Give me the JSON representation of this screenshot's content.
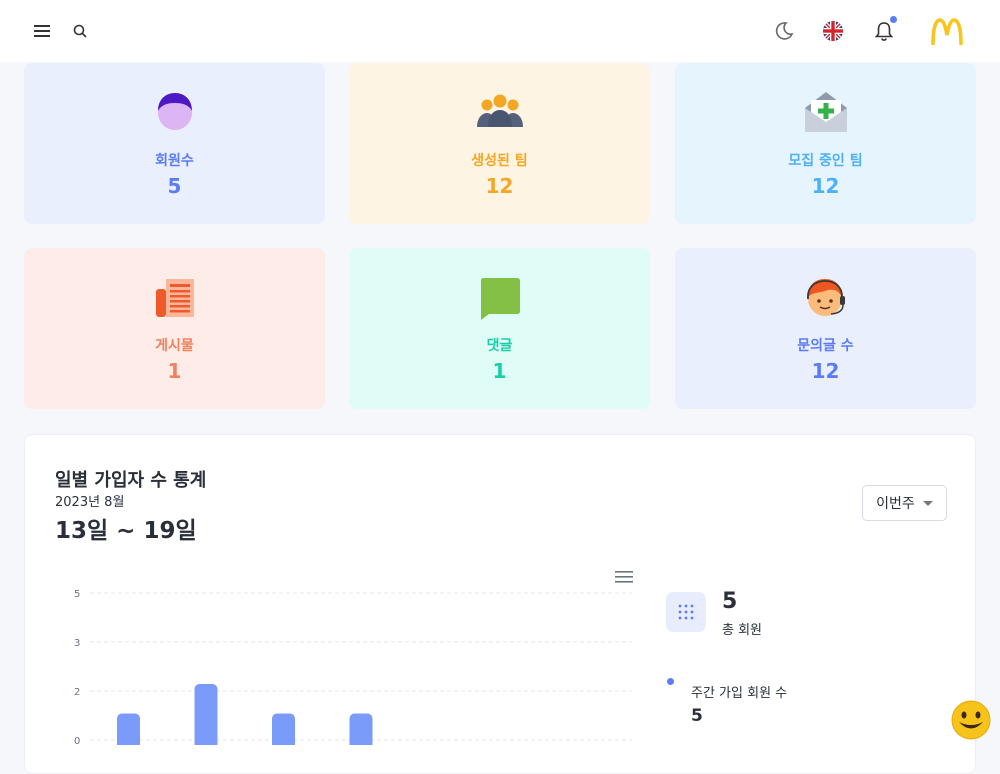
{
  "topbar": {
    "icons": [
      "menu-icon",
      "search-icon",
      "moon-icon",
      "uk-flag-icon",
      "bell-icon",
      "mcdonalds-logo"
    ],
    "has_notification": true
  },
  "cards": [
    {
      "label": "회원수",
      "value": "5",
      "icon": "person-avatar-icon",
      "bg": "#eaeffd",
      "color": "#5b7cf6"
    },
    {
      "label": "생성된 팀",
      "value": "12",
      "icon": "group-people-icon",
      "bg": "#fef4e4",
      "color": "#f5a623"
    },
    {
      "label": "모집 중인 팀",
      "value": "12",
      "icon": "envelope-plus-icon",
      "bg": "#e6f4fe",
      "color": "#4fb1f5"
    },
    {
      "label": "게시물",
      "value": "1",
      "icon": "newspaper-icon",
      "bg": "#fdece7",
      "color": "#f1805d"
    },
    {
      "label": "댓글",
      "value": "1",
      "icon": "speech-bubble-icon",
      "bg": "#e0fcf6",
      "color": "#19cfa9"
    },
    {
      "label": "문의글 수",
      "value": "12",
      "icon": "support-agent-icon",
      "bg": "#eaeffd",
      "color": "#5b7cf6"
    }
  ],
  "stats_panel": {
    "title": "일별 가입자 수 통계",
    "month": "2023년 8월",
    "range": "13일 ~ 19일",
    "period_select": "이번주",
    "total_value": "5",
    "total_label": "총 회원",
    "weekly_label": "주간 가입 회원 수",
    "weekly_value": "5"
  },
  "chart_data": {
    "type": "bar",
    "y_ticks": [
      "5",
      "3",
      "2",
      "0"
    ],
    "values": [
      1,
      2,
      1,
      1
    ],
    "color": "#7b9bfa",
    "grid": true
  }
}
